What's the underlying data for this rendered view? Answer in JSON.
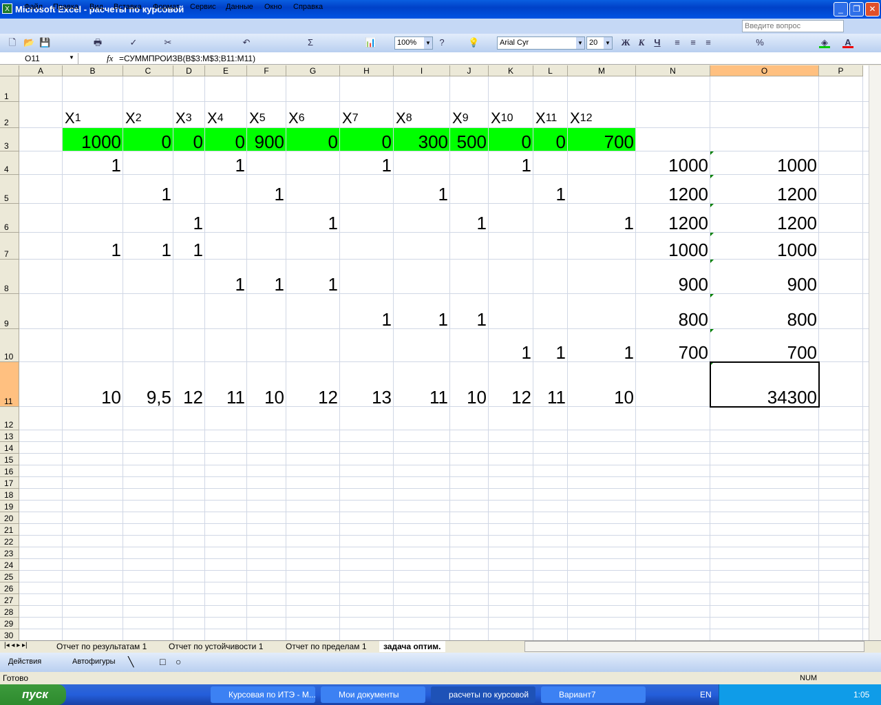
{
  "window": {
    "title": "Microsoft Excel - расчеты по курсовой"
  },
  "menu": [
    "Файл",
    "Правка",
    "Вид",
    "Вставка",
    "Формат",
    "Сервис",
    "Данные",
    "Окно",
    "Справка"
  ],
  "ask_placeholder": "Введите вопрос",
  "toolbar": {
    "zoom": "100%",
    "font": "Arial Cyr",
    "size": "20",
    "bold": "Ж",
    "italic": "К",
    "underline": "Ч",
    "percent": "%"
  },
  "formula_bar": {
    "name_box": "O11",
    "fx": "fx",
    "formula": "=СУММПРОИЗВ(B$3:M$3;B11:M11)"
  },
  "columns": [
    "A",
    "B",
    "C",
    "D",
    "E",
    "F",
    "G",
    "H",
    "I",
    "J",
    "K",
    "L",
    "M",
    "N",
    "O",
    "P"
  ],
  "rows": [
    "1",
    "2",
    "3",
    "4",
    "5",
    "6",
    "7",
    "8",
    "9",
    "10",
    "11",
    "12",
    "13",
    "14",
    "15",
    "16",
    "17",
    "18",
    "19",
    "20",
    "21",
    "22",
    "23",
    "24",
    "25",
    "26",
    "27",
    "28",
    "29",
    "30"
  ],
  "header_row": {
    "base": "X",
    "subs": [
      "1",
      "2",
      "3",
      "4",
      "5",
      "6",
      "7",
      "8",
      "9",
      "10",
      "11",
      "12"
    ]
  },
  "cells": {
    "3": {
      "B": "1000",
      "C": "0",
      "D": "0",
      "E": "0",
      "F": "900",
      "G": "0",
      "H": "0",
      "I": "300",
      "J": "500",
      "K": "0",
      "L": "0",
      "M": "700"
    },
    "4": {
      "B": "1",
      "E": "1",
      "H": "1",
      "K": "1",
      "N": "1000",
      "O": "1000"
    },
    "5": {
      "C": "1",
      "F": "1",
      "I": "1",
      "L": "1",
      "N": "1200",
      "O": "1200"
    },
    "6": {
      "D": "1",
      "G": "1",
      "J": "1",
      "M": "1",
      "N": "1200",
      "O": "1200"
    },
    "7": {
      "B": "1",
      "C": "1",
      "D": "1",
      "N": "1000",
      "O": "1000"
    },
    "8": {
      "E": "1",
      "F": "1",
      "G": "1",
      "N": "900",
      "O": "900"
    },
    "9": {
      "H": "1",
      "I": "1",
      "J": "1",
      "N": "800",
      "O": "800"
    },
    "10": {
      "K": "1",
      "L": "1",
      "M": "1",
      "N": "700",
      "O": "700"
    },
    "11": {
      "B": "10",
      "C": "9,5",
      "D": "12",
      "E": "11",
      "F": "10",
      "G": "12",
      "H": "13",
      "I": "11",
      "J": "10",
      "K": "12",
      "L": "11",
      "M": "10",
      "O": "34300"
    }
  },
  "colors": {
    "highlight": "#00ff00",
    "selected_header": "#ffc080"
  },
  "sheet_tabs": [
    "Отчет по результатам 1",
    "Отчет по устойчивости 1",
    "Отчет по пределам 1",
    "задача оптим."
  ],
  "drawing": {
    "actions": "Действия",
    "autoshapes": "Автофигуры"
  },
  "status": {
    "text": "Готово",
    "num": "NUM"
  },
  "taskbar": {
    "start": "пуск",
    "tasks": [
      "Курсовая по ИТЭ - М...",
      "Мои документы",
      "расчеты по курсовой",
      "Вариант7"
    ],
    "lang": "EN",
    "clock": "1:05"
  }
}
